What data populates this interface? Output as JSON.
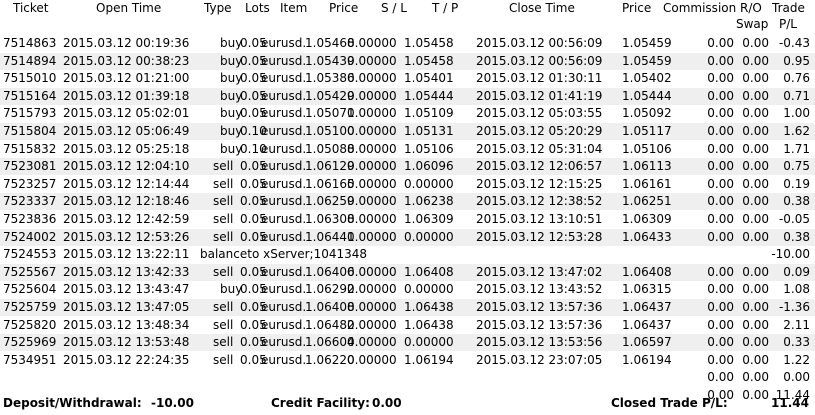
{
  "columns": {
    "ticket": "Ticket",
    "open_time": "Open Time",
    "type": "Type",
    "lots": "Lots",
    "item": "Item",
    "price": "Price",
    "sl": "S / L",
    "tp": "T / P",
    "close_time": "Close Time",
    "close_price": "Price",
    "commission": "Commission",
    "ro_swap_1": "R/O",
    "ro_swap_2": "Swap",
    "trade_pl_1": "Trade",
    "trade_pl_2": "P/L"
  },
  "rows": [
    {
      "ticket": "7514863",
      "open_time": "2015.03.12 00:19:36",
      "type": "buy",
      "lots": "0.05",
      "item": "eurusd.",
      "price": "1.05468",
      "sl": "0.00000",
      "tp": "1.05458",
      "close_time": "2015.03.12 00:56:09",
      "close_price": "1.05459",
      "commission": "0.00",
      "swap": "0.00",
      "pl": "-0.43"
    },
    {
      "ticket": "7514894",
      "open_time": "2015.03.12 00:38:23",
      "type": "buy",
      "lots": "0.05",
      "item": "eurusd.",
      "price": "1.05439",
      "sl": "0.00000",
      "tp": "1.05458",
      "close_time": "2015.03.12 00:56:09",
      "close_price": "1.05459",
      "commission": "0.00",
      "swap": "0.00",
      "pl": "0.95"
    },
    {
      "ticket": "7515010",
      "open_time": "2015.03.12 01:21:00",
      "type": "buy",
      "lots": "0.05",
      "item": "eurusd.",
      "price": "1.05386",
      "sl": "0.00000",
      "tp": "1.05401",
      "close_time": "2015.03.12 01:30:11",
      "close_price": "1.05402",
      "commission": "0.00",
      "swap": "0.00",
      "pl": "0.76"
    },
    {
      "ticket": "7515164",
      "open_time": "2015.03.12 01:39:18",
      "type": "buy",
      "lots": "0.05",
      "item": "eurusd.",
      "price": "1.05429",
      "sl": "0.00000",
      "tp": "1.05444",
      "close_time": "2015.03.12 01:41:19",
      "close_price": "1.05444",
      "commission": "0.00",
      "swap": "0.00",
      "pl": "0.71"
    },
    {
      "ticket": "7515793",
      "open_time": "2015.03.12 05:02:01",
      "type": "buy",
      "lots": "0.05",
      "item": "eurusd.",
      "price": "1.05071",
      "sl": "0.00000",
      "tp": "1.05109",
      "close_time": "2015.03.12 05:03:55",
      "close_price": "1.05092",
      "commission": "0.00",
      "swap": "0.00",
      "pl": "1.00"
    },
    {
      "ticket": "7515804",
      "open_time": "2015.03.12 05:06:49",
      "type": "buy",
      "lots": "0.10",
      "item": "eurusd.",
      "price": "1.05100",
      "sl": "0.00000",
      "tp": "1.05131",
      "close_time": "2015.03.12 05:20:29",
      "close_price": "1.05117",
      "commission": "0.00",
      "swap": "0.00",
      "pl": "1.62"
    },
    {
      "ticket": "7515832",
      "open_time": "2015.03.12 05:25:18",
      "type": "buy",
      "lots": "0.10",
      "item": "eurusd.",
      "price": "1.05088",
      "sl": "0.00000",
      "tp": "1.05106",
      "close_time": "2015.03.12 05:31:04",
      "close_price": "1.05106",
      "commission": "0.00",
      "swap": "0.00",
      "pl": "1.71"
    },
    {
      "ticket": "7523081",
      "open_time": "2015.03.12 12:04:10",
      "type": "sell",
      "lots": "0.05",
      "item": "eurusd.",
      "price": "1.06129",
      "sl": "0.00000",
      "tp": "1.06096",
      "close_time": "2015.03.12 12:06:57",
      "close_price": "1.06113",
      "commission": "0.00",
      "swap": "0.00",
      "pl": "0.75"
    },
    {
      "ticket": "7523257",
      "open_time": "2015.03.12 12:14:44",
      "type": "sell",
      "lots": "0.05",
      "item": "eurusd.",
      "price": "1.06165",
      "sl": "0.00000",
      "tp": "0.00000",
      "close_time": "2015.03.12 12:15:25",
      "close_price": "1.06161",
      "commission": "0.00",
      "swap": "0.00",
      "pl": "0.19"
    },
    {
      "ticket": "7523337",
      "open_time": "2015.03.12 12:18:46",
      "type": "sell",
      "lots": "0.05",
      "item": "eurusd.",
      "price": "1.06259",
      "sl": "0.00000",
      "tp": "1.06238",
      "close_time": "2015.03.12 12:38:52",
      "close_price": "1.06251",
      "commission": "0.00",
      "swap": "0.00",
      "pl": "0.38"
    },
    {
      "ticket": "7523836",
      "open_time": "2015.03.12 12:42:59",
      "type": "sell",
      "lots": "0.05",
      "item": "eurusd.",
      "price": "1.06308",
      "sl": "0.00000",
      "tp": "1.06309",
      "close_time": "2015.03.12 13:10:51",
      "close_price": "1.06309",
      "commission": "0.00",
      "swap": "0.00",
      "pl": "-0.05"
    },
    {
      "ticket": "7524002",
      "open_time": "2015.03.12 12:53:26",
      "type": "sell",
      "lots": "0.05",
      "item": "eurusd.",
      "price": "1.06441",
      "sl": "0.00000",
      "tp": "0.00000",
      "close_time": "2015.03.12 12:53:28",
      "close_price": "1.06433",
      "commission": "0.00",
      "swap": "0.00",
      "pl": "0.38"
    },
    {
      "ticket": "7524553",
      "open_time": "2015.03.12 13:22:11",
      "balance_text": "balanceto xServer;1041348",
      "pl": "-10.00"
    },
    {
      "ticket": "7525567",
      "open_time": "2015.03.12 13:42:33",
      "type": "sell",
      "lots": "0.05",
      "item": "eurusd.",
      "price": "1.06406",
      "sl": "0.00000",
      "tp": "1.06408",
      "close_time": "2015.03.12 13:47:02",
      "close_price": "1.06408",
      "commission": "0.00",
      "swap": "0.00",
      "pl": "0.09"
    },
    {
      "ticket": "7525604",
      "open_time": "2015.03.12 13:43:47",
      "type": "buy",
      "lots": "0.05",
      "item": "eurusd.",
      "price": "1.06292",
      "sl": "0.00000",
      "tp": "0.00000",
      "close_time": "2015.03.12 13:43:52",
      "close_price": "1.06315",
      "commission": "0.00",
      "swap": "0.00",
      "pl": "1.08"
    },
    {
      "ticket": "7525759",
      "open_time": "2015.03.12 13:47:05",
      "type": "sell",
      "lots": "0.05",
      "item": "eurusd.",
      "price": "1.06408",
      "sl": "0.00000",
      "tp": "1.06438",
      "close_time": "2015.03.12 13:57:36",
      "close_price": "1.06437",
      "commission": "0.00",
      "swap": "0.00",
      "pl": "-1.36"
    },
    {
      "ticket": "7525820",
      "open_time": "2015.03.12 13:48:34",
      "type": "sell",
      "lots": "0.05",
      "item": "eurusd.",
      "price": "1.06482",
      "sl": "0.00000",
      "tp": "1.06438",
      "close_time": "2015.03.12 13:57:36",
      "close_price": "1.06437",
      "commission": "0.00",
      "swap": "0.00",
      "pl": "2.11"
    },
    {
      "ticket": "7525969",
      "open_time": "2015.03.12 13:53:48",
      "type": "sell",
      "lots": "0.05",
      "item": "eurusd.",
      "price": "1.06604",
      "sl": "0.00000",
      "tp": "0.00000",
      "close_time": "2015.03.12 13:53:56",
      "close_price": "1.06597",
      "commission": "0.00",
      "swap": "0.00",
      "pl": "0.33"
    },
    {
      "ticket": "7534951",
      "open_time": "2015.03.12 22:24:35",
      "type": "sell",
      "lots": "0.05",
      "item": "eurusd.",
      "price": "1.06220",
      "sl": "0.00000",
      "tp": "1.06194",
      "close_time": "2015.03.12 23:07:05",
      "close_price": "1.06194",
      "commission": "0.00",
      "swap": "0.00",
      "pl": "1.22"
    }
  ],
  "totals": [
    {
      "commission": "0.00",
      "swap": "0.00",
      "pl": "0.00"
    },
    {
      "commission": "0.00",
      "swap": "0.00",
      "pl": "11.44"
    }
  ],
  "summary": {
    "deposit_label": "Deposit/Withdrawal:",
    "deposit_value": "-10.00",
    "credit_label": "Credit Facility:",
    "credit_value": "0.00",
    "closed_label": "Closed Trade P/L:",
    "closed_value": "11.44"
  }
}
